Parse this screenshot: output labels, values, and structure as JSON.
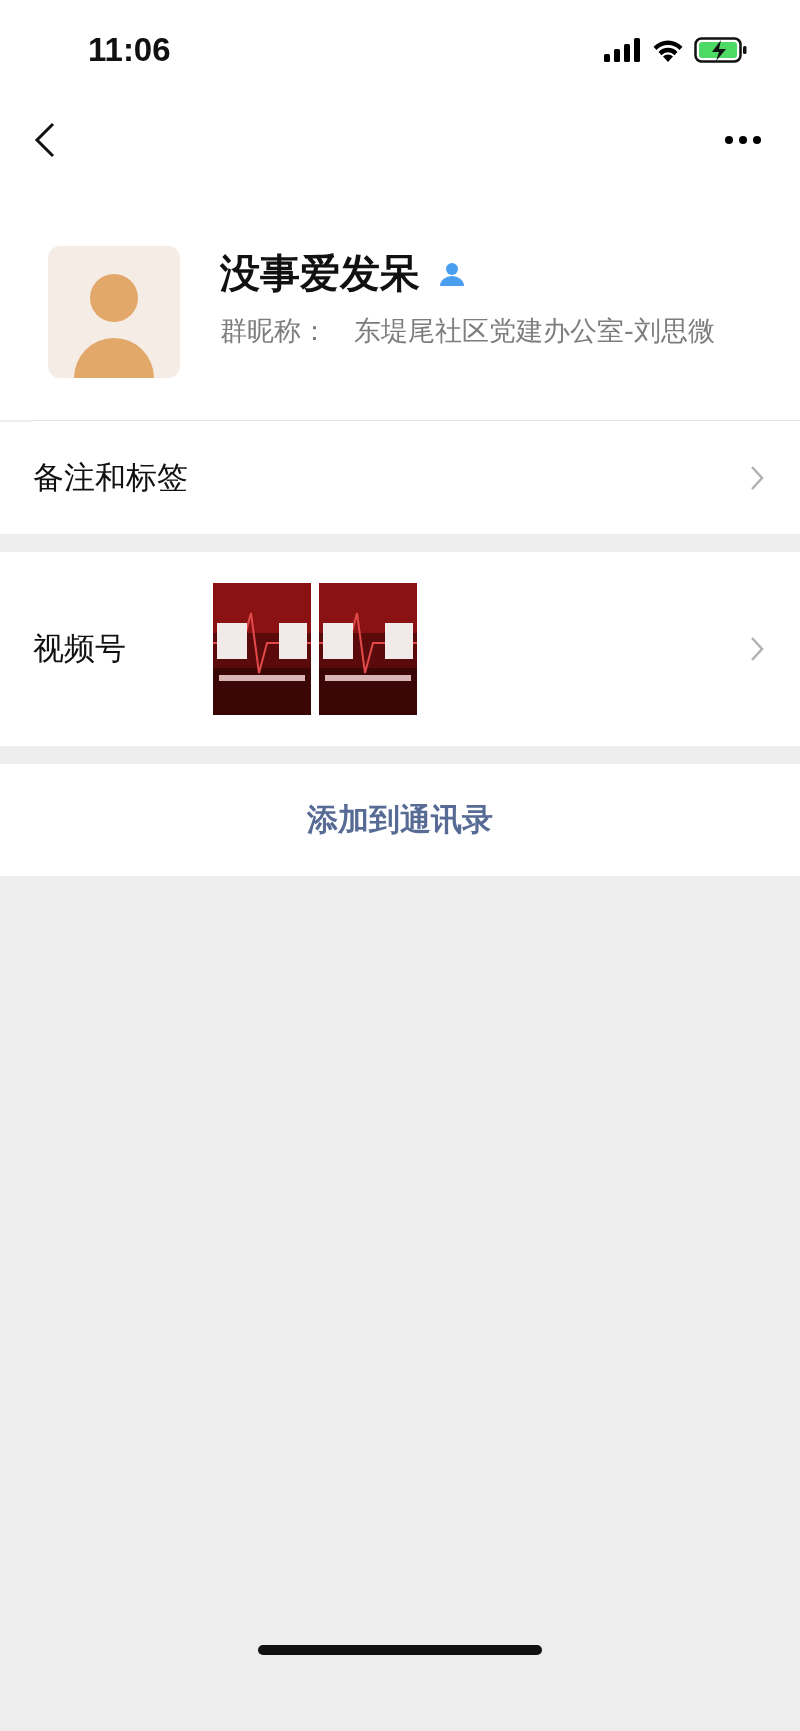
{
  "status_bar": {
    "time": "11:06"
  },
  "profile": {
    "name": "没事爱发呆",
    "nickname_label": "群昵称：",
    "nickname": "东堤尾社区党建办公室-刘思微"
  },
  "rows": [
    {
      "kind": "link",
      "label": "备注和标签"
    },
    {
      "kind": "media",
      "label": "视频号"
    }
  ],
  "action": {
    "label": "添加到通讯录"
  }
}
